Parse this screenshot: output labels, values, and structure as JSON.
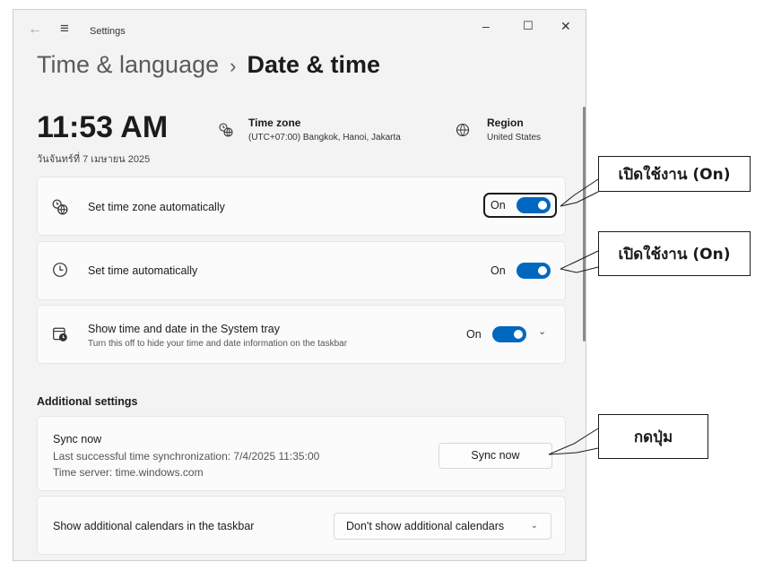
{
  "window": {
    "back_icon": "←",
    "menu_icon": "≡",
    "app_title": "Settings",
    "minimize_icon": "–",
    "maximize_icon": "☐",
    "close_icon": "✕"
  },
  "breadcrumb": {
    "parent": "Time & language",
    "separator": "›",
    "current": "Date & time"
  },
  "clock": {
    "time": "11:53 AM",
    "date": "วันจันทร์ที่ 7 เมษายน 2025"
  },
  "time_zone": {
    "icon": "globe-clock-icon",
    "label": "Time zone",
    "value": "(UTC+07:00) Bangkok, Hanoi, Jakarta"
  },
  "region": {
    "icon": "globe-icon",
    "label": "Region",
    "value": "United States"
  },
  "settings": [
    {
      "label": "Set time zone automatically",
      "state": "On",
      "icon": "globe-clock-icon"
    },
    {
      "label": "Set time automatically",
      "state": "On",
      "icon": "clock-icon"
    },
    {
      "label": "Show time and date in the System tray",
      "sub": "Turn this off to hide your time and date information on the taskbar",
      "state": "On",
      "icon": "calendar-clock-icon",
      "chevron": "⌄"
    }
  ],
  "additional": {
    "heading": "Additional settings",
    "sync": {
      "title": "Sync now",
      "last_sync": "Last successful time synchronization: 7/4/2025 11:35:00",
      "server": "Time server: time.windows.com",
      "button": "Sync now"
    },
    "calendars": {
      "label": "Show additional calendars in the taskbar",
      "dropdown_value": "Don't show additional calendars",
      "dropdown_chevron": "⌄"
    }
  },
  "callouts": {
    "c1": "เปิดใช้งาน (On)",
    "c2": "เปิดใช้งาน (On)",
    "c3": "กดปุ่ม"
  },
  "colors": {
    "accent": "#0067c0",
    "window_bg": "#f3f3f3",
    "card_bg": "#fbfbfb"
  }
}
